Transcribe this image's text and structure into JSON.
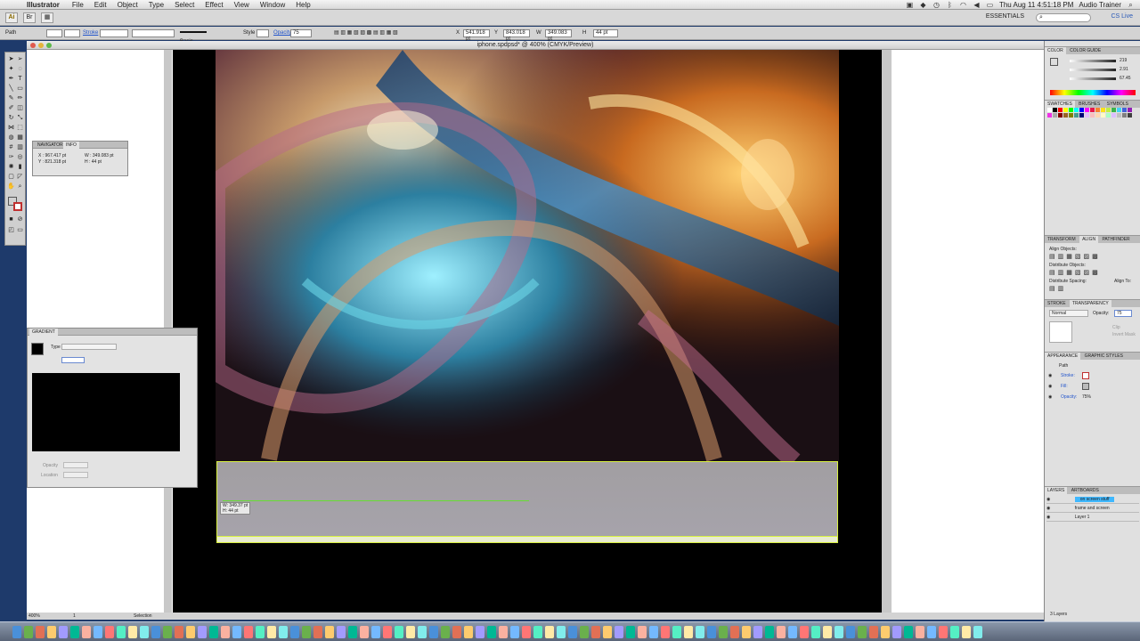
{
  "menubar": {
    "app": "Illustrator",
    "menus": [
      "File",
      "Edit",
      "Object",
      "Type",
      "Select",
      "Effect",
      "View",
      "Window",
      "Help"
    ],
    "clock": "Thu Aug 11  4:51:18 PM",
    "user": "Audio Trainer"
  },
  "appbar": {
    "workspace": "ESSENTIALS",
    "cs_live": "CS Live"
  },
  "control": {
    "selection": "Path",
    "stroke_label": "Stroke",
    "brush": "Basic",
    "style_label": "Style",
    "opacity_label": "Opacity",
    "opacity_value": "75",
    "x_label": "X",
    "x_value": "541.918 pt",
    "y_label": "Y",
    "y_value": "843.018 pt",
    "w_label": "W",
    "w_value": "349.083 pt",
    "h_label": "H",
    "h_value": "44 pt"
  },
  "document": {
    "title": "iphone.spdpsd* @ 400% (CMYK/Preview)"
  },
  "info_panel": {
    "tabs": [
      "NAVIGATOR",
      "INFO"
    ],
    "x": "X : 967.417 pt",
    "y": "Y : 821.318 pt",
    "w": "W : 349.083 pt",
    "h": "H : 44 pt"
  },
  "gradient_panel": {
    "title": "GRADIENT",
    "type_label": "Type",
    "opacity_label": "Opacity",
    "location_label": "Location"
  },
  "tooltip": {
    "w": "W: 349.37 pt",
    "h": "H: 44 pt"
  },
  "dock": {
    "color_tabs": [
      "COLOR",
      "COLOR GUIDE"
    ],
    "c_value": "219",
    "m_value": "2.91",
    "y_value": "67.45",
    "swatch_tabs": [
      "SWATCHES",
      "BRUSHES",
      "SYMBOLS"
    ],
    "align_tabs": [
      "TRANSFORM",
      "ALIGN",
      "PATHFINDER"
    ],
    "align_objects": "Align Objects:",
    "distribute_objects": "Distribute Objects:",
    "distribute_spacing": "Distribute Spacing:",
    "align_to": "Align To:",
    "stroke_tabs": [
      "STROKE",
      "TRANSPARENCY"
    ],
    "blend_mode": "Normal",
    "opacity_label": "Opacity:",
    "opacity_value": "75",
    "clip": "Clip",
    "invert_mask": "Invert Mask",
    "appearance_tabs": [
      "APPEARANCE",
      "GRAPHIC STYLES"
    ],
    "appearance_title": "Path",
    "appearance_rows": [
      "Stroke:",
      "Fill:",
      "Opacity:"
    ],
    "appearance_opacity": "75%",
    "layers_tabs": [
      "LAYERS",
      "ARTBOARDS"
    ],
    "layers": [
      "on screen stuff",
      "frame and screen",
      "Layer 1"
    ],
    "layers_count": "3 Layers"
  },
  "status": {
    "zoom": "400%",
    "page": "1",
    "tool": "Selection"
  },
  "colors": {
    "selection_outline": "#d8f040",
    "guide": "#66dd33",
    "layer_highlight": "#3fb8ff",
    "link_blue": "#2255cc"
  }
}
